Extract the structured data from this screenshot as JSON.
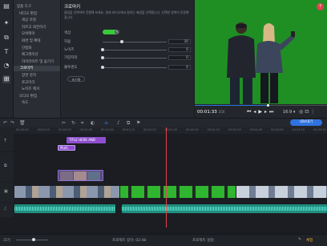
{
  "sidebar": {
    "items": [
      {
        "label": "맞춤 도구",
        "level": 0
      },
      {
        "label": "비디오 편집",
        "level": 1
      },
      {
        "label": "색상 조정",
        "level": 2
      },
      {
        "label": "자르고 회전하기",
        "level": 2
      },
      {
        "label": "오버레이",
        "level": 2
      },
      {
        "label": "화면 및 확대",
        "level": 2
      },
      {
        "label": "안정화",
        "level": 2
      },
      {
        "label": "페그레이션",
        "level": 2
      },
      {
        "label": "하이라이트 및 숨기기",
        "level": 2
      },
      {
        "label": "크로마키",
        "level": 2,
        "selected": true
      },
      {
        "label": "장면 감지",
        "level": 2
      },
      {
        "label": "로고마크",
        "level": 2
      },
      {
        "label": "노이즈 제거",
        "level": 2
      },
      {
        "label": "오디오 편집",
        "level": 1
      },
      {
        "label": "속도",
        "level": 2
      }
    ]
  },
  "panel": {
    "title": "크로마키",
    "description": "클립을 선택하여 진행해 보세요. 원래 비디오에서 원하는 배경을 선택합니다. 선택한 영역이 투명해집니다.",
    "color_label": "색상",
    "sliders": [
      {
        "label": "허용",
        "value": "30",
        "level": 0.3
      },
      {
        "label": "노이즈",
        "value": "0",
        "level": 0.0
      },
      {
        "label": "가장자리",
        "value": "0",
        "level": 0.0
      },
      {
        "label": "불투명도",
        "value": "0",
        "level": 0.0
      }
    ],
    "reset_label": "초기화"
  },
  "player": {
    "time_current": "00:01:33",
    "time_fraction": "250",
    "aspect": "16:9",
    "help_label": "?"
  },
  "toolbar": {
    "export_label": "내보내기"
  },
  "ruler": {
    "ticks": [
      "00:00:00",
      "00:00:15",
      "00:00:30",
      "00:00:45",
      "00:01:00",
      "00:01:15",
      "00:01:30",
      "00:01:45",
      "00:02:00",
      "00:02:15",
      "00:02:30",
      "00:02:45",
      "00:03:00",
      "00:03:15",
      "00:03:30"
    ]
  },
  "timeline": {
    "title_clip": "TITLE HERE AND",
    "effect_clip": "Multi"
  },
  "status": {
    "scale_label": "크기:",
    "duration_label": "프로젝트 길이: 02:48",
    "project_label": "프로젝트 설정:",
    "trial_label": "체험"
  },
  "colors": {
    "accent": "#2f73e0",
    "chroma_green": "#1f8f24",
    "clip_purple": "#8e4fcf",
    "audio_teal": "#25b8a4",
    "playhead_red": "#e0454f"
  }
}
